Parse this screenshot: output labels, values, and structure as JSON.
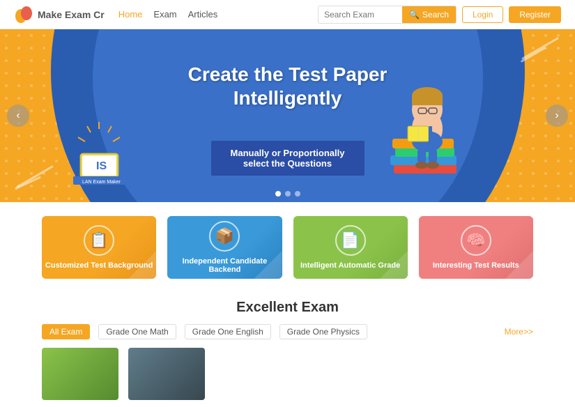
{
  "header": {
    "logo_text": "Make Exam Cr",
    "nav": [
      {
        "label": "Home",
        "active": true
      },
      {
        "label": "Exam",
        "active": false
      },
      {
        "label": "Articles",
        "active": false
      }
    ],
    "search_placeholder": "Search Exam",
    "search_button": "Search",
    "login_label": "Login",
    "register_label": "Register"
  },
  "hero": {
    "title": "Create the Test Paper Intelligently",
    "subtitle": "Manually or Proportionally select the Questions",
    "prev_label": "‹",
    "next_label": "›",
    "dots": [
      {
        "active": true
      },
      {
        "active": false
      },
      {
        "active": false
      }
    ]
  },
  "features": [
    {
      "label": "Customized Test Background",
      "icon": "📋",
      "color": "orange"
    },
    {
      "label": "Independent Candidate Backend",
      "icon": "📦",
      "color": "blue"
    },
    {
      "label": "Intelligent Automatic Grade",
      "icon": "📄",
      "color": "green"
    },
    {
      "label": "Interesting Test Results",
      "icon": "🧠",
      "color": "salmon"
    }
  ],
  "excellent_exam": {
    "title": "Excellent Exam",
    "tabs": [
      {
        "label": "All Exam",
        "active": true
      },
      {
        "label": "Grade One Math",
        "active": false
      },
      {
        "label": "Grade One English",
        "active": false
      },
      {
        "label": "Grade One Physics",
        "active": false
      }
    ],
    "more_label": "More>>"
  }
}
